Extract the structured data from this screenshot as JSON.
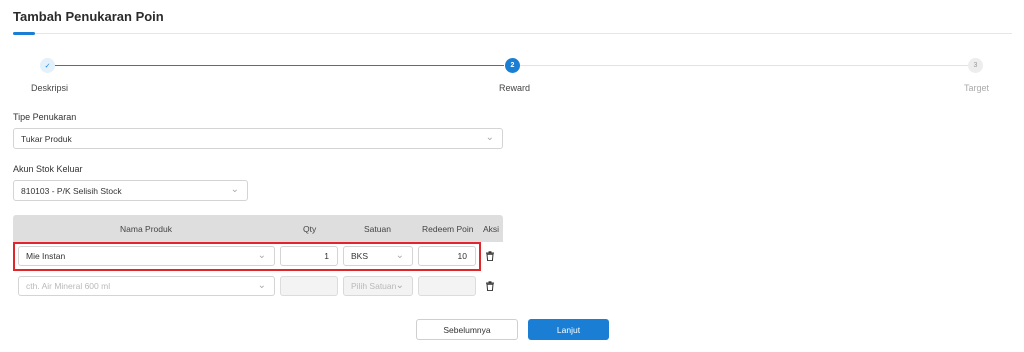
{
  "page": {
    "title": "Tambah Penukaran Poin"
  },
  "stepper": {
    "steps": [
      {
        "number": "✓",
        "label": "Deskripsi",
        "state": "done"
      },
      {
        "number": "2",
        "label": "Reward",
        "state": "active"
      },
      {
        "number": "3",
        "label": "Target",
        "state": "todo"
      }
    ]
  },
  "form": {
    "tipe_label": "Tipe Penukaran",
    "tipe_value": "Tukar Produk",
    "akun_label": "Akun Stok Keluar",
    "akun_value": "810103 - P/K Selisih Stock"
  },
  "table": {
    "columns": [
      "Nama Produk",
      "Qty",
      "Satuan",
      "Redeem Poin",
      "Aksi"
    ],
    "rows": [
      {
        "product": "Mie Instan",
        "qty": "1",
        "unit": "BKS",
        "points": "10"
      }
    ],
    "new_row": {
      "product_placeholder": "cth. Air Mineral 600 ml",
      "unit_placeholder": "Pilih Satuan"
    }
  },
  "buttons": {
    "back": "Sebelumnya",
    "next": "Lanjut"
  },
  "colors": {
    "primary": "#1a7fd4",
    "highlight": "#e0262a"
  }
}
